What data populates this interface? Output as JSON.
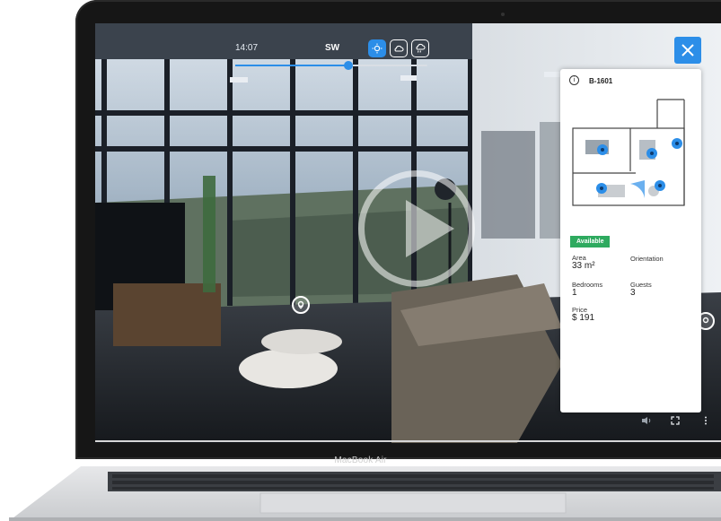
{
  "device": {
    "label": "MacBook Air"
  },
  "tour": {
    "time": "14:07",
    "compass": "SW",
    "daylight_percent": 59,
    "weather_options": [
      {
        "name": "sun-icon",
        "active": true
      },
      {
        "name": "cloud-icon",
        "active": false
      },
      {
        "name": "rain-cloud-icon",
        "active": false
      }
    ]
  },
  "panel": {
    "unit_id": "B-1601",
    "status": "Available",
    "area_label": "Area",
    "area_value": "33 m²",
    "orientation_label": "Orientation",
    "bedrooms_label": "Bedrooms",
    "bedrooms_value": "1",
    "guests_label": "Guests",
    "guests_value": "3",
    "price_label": "Price",
    "price_value": "$ 191"
  },
  "colors": {
    "accent": "#2c8ee8",
    "available": "#2eaa5f"
  }
}
